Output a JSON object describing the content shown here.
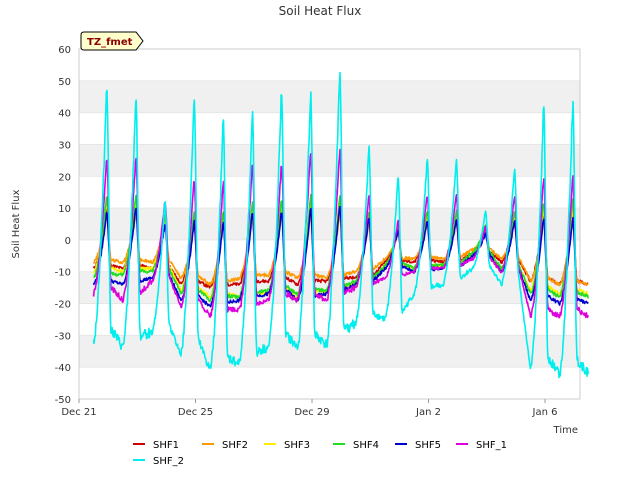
{
  "chart_data": {
    "type": "line",
    "title": "Soil Heat Flux",
    "xlabel": "Time",
    "ylabel": "Soil Heat Flux",
    "badge": "TZ_fmet",
    "xlim": [
      0,
      17.2
    ],
    "ylim": [
      -50,
      60
    ],
    "yticks": [
      -50,
      -40,
      -30,
      -20,
      -10,
      0,
      10,
      20,
      30,
      40,
      50,
      60
    ],
    "xticks": [
      {
        "day": 0,
        "label": "Dec 21"
      },
      {
        "day": 4,
        "label": "Dec 25"
      },
      {
        "day": 8,
        "label": "Dec 29"
      },
      {
        "day": 12,
        "label": "Jan 2"
      },
      {
        "day": 16,
        "label": "Jan 6"
      }
    ],
    "grid": "horizontal bands",
    "legend_position": "bottom",
    "day_offset": 0.5,
    "series": [
      {
        "name": "SHF1",
        "color": "#cc0000",
        "night": [
          -9,
          -9,
          -9,
          -14,
          -15,
          -14,
          -13,
          -14,
          -13,
          -12,
          -7,
          -7,
          -7,
          -4,
          -7,
          -13,
          -14
        ],
        "peak": [
          10,
          10,
          6,
          6,
          6,
          8,
          9,
          10,
          10,
          6,
          3,
          6,
          6,
          3,
          6,
          8,
          8
        ]
      },
      {
        "name": "SHF2",
        "color": "#ff9900",
        "night": [
          -7,
          -7,
          -7,
          -12,
          -14,
          -12,
          -11,
          -12,
          -12,
          -10,
          -6,
          -6,
          -6,
          -3,
          -6,
          -13,
          -14
        ],
        "peak": [
          8,
          8,
          5,
          5,
          5,
          7,
          8,
          8,
          8,
          5,
          2,
          5,
          5,
          2,
          5,
          6,
          6
        ]
      },
      {
        "name": "SHF3",
        "color": "#ffee00",
        "night": [
          -10,
          -10,
          -9,
          -16,
          -18,
          -18,
          -17,
          -18,
          -16,
          -14,
          -8,
          -9,
          -8,
          -5,
          -9,
          -16,
          -17
        ],
        "peak": [
          12,
          12,
          7,
          8,
          8,
          11,
          12,
          13,
          13,
          8,
          4,
          8,
          8,
          4,
          8,
          10,
          10
        ]
      },
      {
        "name": "SHF4",
        "color": "#22dd22",
        "night": [
          -12,
          -11,
          -10,
          -17,
          -19,
          -18,
          -16,
          -17,
          -16,
          -13,
          -8,
          -9,
          -8,
          -4,
          -9,
          -17,
          -18
        ],
        "peak": [
          14,
          14,
          8,
          9,
          9,
          12,
          13,
          14,
          14,
          9,
          4,
          9,
          9,
          5,
          9,
          12,
          13
        ]
      },
      {
        "name": "SHF5",
        "color": "#0000cc",
        "night": [
          -14,
          -14,
          -12,
          -19,
          -21,
          -19,
          -17,
          -19,
          -17,
          -14,
          -9,
          -10,
          -9,
          -5,
          -10,
          -19,
          -20
        ],
        "peak": [
          9,
          10,
          5,
          6,
          6,
          9,
          9,
          10,
          11,
          7,
          3,
          6,
          6,
          2,
          6,
          7,
          7
        ]
      },
      {
        "name": "SHF_1",
        "color": "#dd00dd",
        "night": [
          -17,
          -19,
          -13,
          -21,
          -24,
          -22,
          -19,
          -19,
          -19,
          -15,
          -12,
          -10,
          -9,
          -6,
          -10,
          -24,
          -24
        ],
        "peak": [
          26,
          26,
          12,
          19,
          18,
          24,
          24,
          28,
          28,
          14,
          6,
          14,
          14,
          4,
          14,
          20,
          20
        ]
      },
      {
        "name": "SHF_2",
        "color": "#00eeee",
        "night": [
          -32,
          -34,
          -29,
          -36,
          -41,
          -39,
          -34,
          -34,
          -33,
          -26,
          -25,
          -17,
          -14,
          -9,
          -14,
          -41,
          -42
        ],
        "peak": [
          49,
          45,
          13,
          45,
          38,
          40,
          47,
          46,
          53,
          29,
          20,
          25,
          25,
          9,
          22,
          43,
          43
        ]
      }
    ]
  }
}
